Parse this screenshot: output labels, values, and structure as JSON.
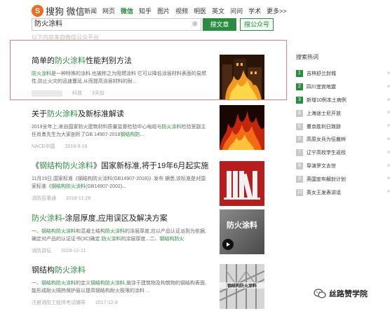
{
  "header": {
    "logo_glyph": "S",
    "logo_text": "搜狗 微信",
    "nav": [
      {
        "label": "新闻",
        "active": false
      },
      {
        "label": "网页",
        "active": false
      },
      {
        "label": "微信",
        "active": true
      },
      {
        "label": "知乎",
        "active": false
      },
      {
        "label": "图片",
        "active": false
      },
      {
        "label": "视频",
        "active": false
      },
      {
        "label": "明医",
        "active": false
      },
      {
        "label": "英文",
        "active": false
      },
      {
        "label": "问问",
        "active": false
      },
      {
        "label": "学术",
        "active": false
      },
      {
        "label": "更多>>",
        "active": false
      }
    ],
    "search_value": "防火涂料",
    "search_article_button": "搜文章",
    "search_official_button": "搜公众号",
    "hint": "以下内容来自微信公众平台"
  },
  "results": [
    {
      "title": [
        {
          "t": "简单的",
          "kw": false
        },
        {
          "t": "防火涂料",
          "kw": true
        },
        {
          "t": "性能判别方法",
          "kw": false
        }
      ],
      "snippet": [
        {
          "t": "防火涂料",
          "kw": true
        },
        {
          "t": "是一种特殊的涂料,也被称之为阻燃涂料 它可以降低涂层材料表面的易燃性,防止火灾的迅速蔓延,从而提高涂层材料的耐...",
          "kw": false
        }
      ],
      "meta_source": "科技",
      "meta_time": "3天前",
      "thumb": "fire-building"
    },
    {
      "title": [
        {
          "t": "关于",
          "kw": false
        },
        {
          "t": "防火涂料",
          "kw": true
        },
        {
          "t": "及新标准解读",
          "kw": false
        }
      ],
      "snippet": [
        {
          "t": "2019全年上,来自国家防火建筑材料质量监督检验中心电缆与",
          "kw": false
        },
        {
          "t": "防火涂料",
          "kw": true
        },
        {
          "t": "检验室副主任肖勇先生为大家剖析了GB 14907-2018",
          "kw": false
        },
        {
          "t": "钢结构防",
          "kw": true
        },
        {
          "t": "...",
          "kw": false
        }
      ],
      "meta_source": "NACE中国",
      "meta_time": "2019-9-16",
      "thumb": "flames"
    },
    {
      "title": [
        {
          "t": "《",
          "kw": false
        },
        {
          "t": "钢结构防火涂料",
          "kw": true
        },
        {
          "t": "》国家新标准,将于19年6月起实施",
          "kw": false
        }
      ],
      "snippet": [
        {
          "t": "11月19日,国家标准《钢结构防火涂料(GB14907-2018)》发布 据悉,该标准是对国家标准《",
          "kw": false
        },
        {
          "t": "钢结构防火涂料",
          "kw": true
        },
        {
          "t": "(GB14907-2002)...",
          "kw": false
        }
      ],
      "meta_source": "消防百事通",
      "meta_time": "2018-11-28",
      "thumb": "books"
    },
    {
      "title": [
        {
          "t": "防火涂料",
          "kw": true
        },
        {
          "t": "-涂层厚度,应用误区及解决方案",
          "kw": false
        }
      ],
      "snippet": [
        {
          "t": "一、",
          "kw": false
        },
        {
          "t": "钢结构防火涂料",
          "kw": true
        },
        {
          "t": "和混凝土结构",
          "kw": false
        },
        {
          "t": "防火涂料",
          "kw": true
        },
        {
          "t": "的涂层厚度,应以产品认证派到为依据,确定对产品的认证证书(3C)确定 ",
          "kw": false
        },
        {
          "t": "防火涂料",
          "kw": true
        },
        {
          "t": "的涂层厚度...二、",
          "kw": false
        },
        {
          "t": "钢结构防火",
          "kw": true
        }
      ],
      "meta_source": "消防讲坛",
      "meta_time": "2018-12-11",
      "thumb": "video",
      "thumb_text": "防火涂料"
    },
    {
      "title": [
        {
          "t": "钢结构",
          "kw": false
        },
        {
          "t": "防火涂料",
          "kw": true
        }
      ],
      "snippet": [
        {
          "t": "一、",
          "kw": false
        },
        {
          "t": "钢结构防火涂料",
          "kw": true
        },
        {
          "t": "的定义",
          "kw": false
        },
        {
          "t": "钢结构防火涂料",
          "kw": true
        },
        {
          "t": ",施涂于建筑物及构筑物的钢结构表面,能形成耐火隔热保护层以提高钢结构耐火极限的涂料 ...",
          "kw": false
        }
      ],
      "meta_source": "注册消防工程师考试辅导",
      "meta_time": "2017-12-8",
      "thumb": "steel",
      "thumb_text": "钢结构防火涂料"
    }
  ],
  "sidebar": {
    "title": "搜索热词",
    "items": [
      {
        "rank": "1",
        "label": "吉林舒兰封城"
      },
      {
        "rank": "2",
        "label": "四川宜宾地震"
      },
      {
        "rank": "3",
        "label": "新增10例本土病例"
      },
      {
        "rank": "4",
        "label": "上海途士尼开放"
      },
      {
        "rank": "5",
        "label": "曹京胜利日致辞"
      },
      {
        "rank": "6",
        "label": "高原女兵为伍裁辫"
      },
      {
        "rank": "7",
        "label": "辽宁高校学生返校"
      },
      {
        "rank": "8",
        "label": "导演罗文去世"
      },
      {
        "rank": "9",
        "label": "英国宣布解封计划"
      },
      {
        "rank": "10",
        "label": "英女王发表讲话"
      }
    ]
  },
  "watermark": {
    "text": "丝路赞学院"
  },
  "colors": {
    "accent": "#2a8c3f",
    "logo": "#f26b1d",
    "frame": "#e77d7d"
  }
}
